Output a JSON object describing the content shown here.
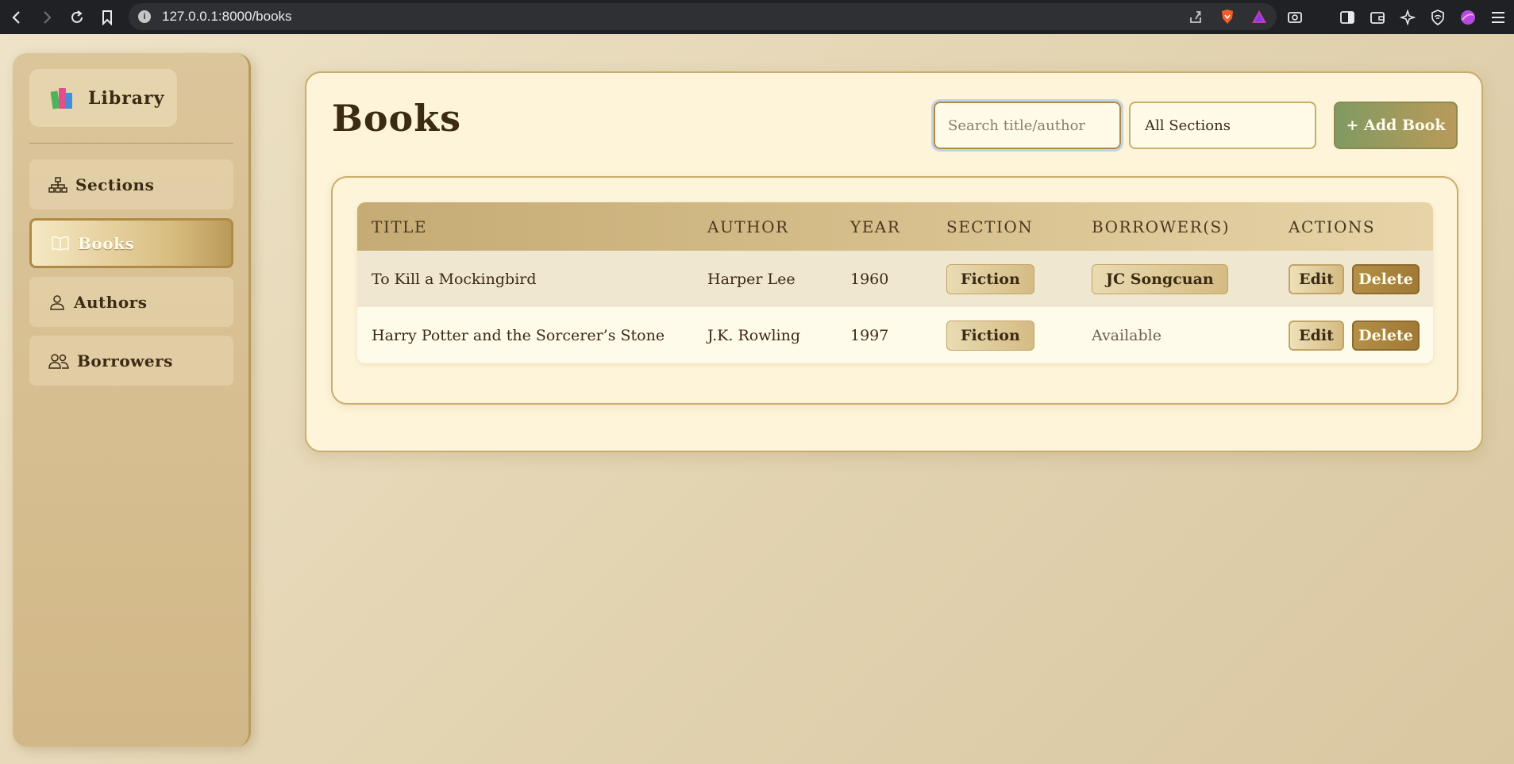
{
  "browser": {
    "url": "127.0.0.1:8000/books",
    "info_icon": "i"
  },
  "sidebar": {
    "brand": "Library",
    "items": [
      {
        "label": "Sections",
        "icon": "sitemap-icon",
        "active": false
      },
      {
        "label": "Books",
        "icon": "book-open-icon",
        "active": true
      },
      {
        "label": "Authors",
        "icon": "user-icon",
        "active": false
      },
      {
        "label": "Borrowers",
        "icon": "users-icon",
        "active": false
      }
    ]
  },
  "main": {
    "title": "Books",
    "search_placeholder": "Search title/author",
    "section_filter": "All Sections",
    "add_label": "+ Add Book"
  },
  "table": {
    "headers": [
      "TITLE",
      "AUTHOR",
      "YEAR",
      "SECTION",
      "BORROWER(S)",
      "ACTIONS"
    ],
    "rows": [
      {
        "title": "To Kill a Mockingbird",
        "author": "Harper Lee",
        "year": "1960",
        "section": "Fiction",
        "borrower": "JC Songcuan",
        "borrowed": true
      },
      {
        "title": "Harry Potter and the Sorcerer’s Stone",
        "author": "J.K. Rowling",
        "year": "1997",
        "section": "Fiction",
        "borrower": "Available",
        "borrowed": false
      }
    ],
    "edit_label": "Edit",
    "delete_label": "Delete"
  },
  "colors": {
    "accent": "#b08a44",
    "add_button": "#7f9a62",
    "delete_button": "#a07a35",
    "card_bg": "#fdf4d9"
  }
}
